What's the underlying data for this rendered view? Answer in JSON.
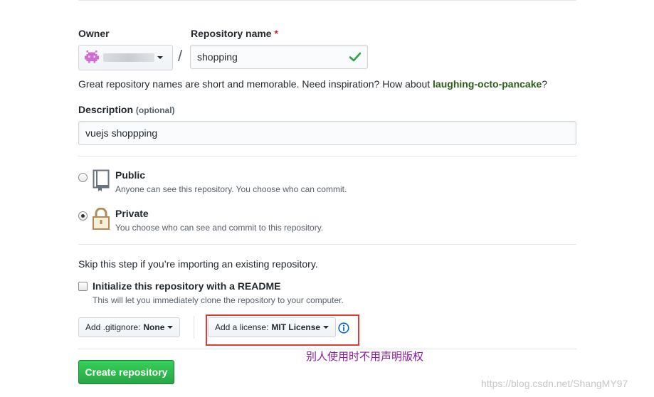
{
  "owner": {
    "label": "Owner",
    "value_masked": ""
  },
  "repo_name": {
    "label": "Repository name",
    "required_marker": "*",
    "value": "shopping",
    "separator": "/"
  },
  "name_hint": {
    "prefix": "Great repository names are short and memorable. Need inspiration? How about ",
    "suggestion": "laughing-octo-pancake",
    "suffix": "?"
  },
  "description": {
    "label": "Description",
    "optional": "(optional)",
    "value": "vuejs shoppping"
  },
  "visibility": {
    "public": {
      "title": "Public",
      "desc": "Anyone can see this repository. You choose who can commit.",
      "selected": false
    },
    "private": {
      "title": "Private",
      "desc": "You choose who can see and commit to this repository.",
      "selected": true
    }
  },
  "init": {
    "skip_text": "Skip this step if you’re importing an existing repository.",
    "readme_label": "Initialize this repository with a README",
    "readme_desc": "This will let you immediately clone the repository to your computer.",
    "readme_checked": false
  },
  "gitignore": {
    "prefix": "Add .gitignore:",
    "value": "None"
  },
  "license": {
    "prefix": "Add a license:",
    "value": "MIT License"
  },
  "annotation": {
    "text": "别人使用时不用声明版权",
    "color": "#8b1a9e",
    "box_color": "#e53935"
  },
  "create_button": {
    "label": "Create repository"
  },
  "watermark": "https://blog.csdn.net/ShangMY97",
  "colors": {
    "accent_green": "#28a745",
    "link_green": "#2c5b1a",
    "check_green": "#28a745",
    "info_blue": "#0366d6"
  }
}
